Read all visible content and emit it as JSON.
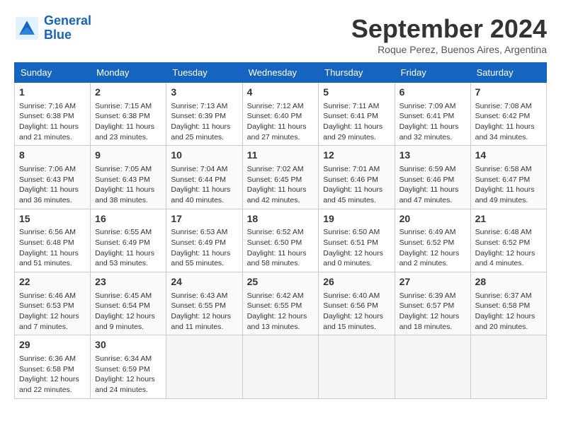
{
  "header": {
    "logo_line1": "General",
    "logo_line2": "Blue",
    "month": "September 2024",
    "location": "Roque Perez, Buenos Aires, Argentina"
  },
  "days_of_week": [
    "Sunday",
    "Monday",
    "Tuesday",
    "Wednesday",
    "Thursday",
    "Friday",
    "Saturday"
  ],
  "weeks": [
    [
      {
        "day": 1,
        "info": "Sunrise: 7:16 AM\nSunset: 6:38 PM\nDaylight: 11 hours\nand 21 minutes."
      },
      {
        "day": 2,
        "info": "Sunrise: 7:15 AM\nSunset: 6:38 PM\nDaylight: 11 hours\nand 23 minutes."
      },
      {
        "day": 3,
        "info": "Sunrise: 7:13 AM\nSunset: 6:39 PM\nDaylight: 11 hours\nand 25 minutes."
      },
      {
        "day": 4,
        "info": "Sunrise: 7:12 AM\nSunset: 6:40 PM\nDaylight: 11 hours\nand 27 minutes."
      },
      {
        "day": 5,
        "info": "Sunrise: 7:11 AM\nSunset: 6:41 PM\nDaylight: 11 hours\nand 29 minutes."
      },
      {
        "day": 6,
        "info": "Sunrise: 7:09 AM\nSunset: 6:41 PM\nDaylight: 11 hours\nand 32 minutes."
      },
      {
        "day": 7,
        "info": "Sunrise: 7:08 AM\nSunset: 6:42 PM\nDaylight: 11 hours\nand 34 minutes."
      }
    ],
    [
      {
        "day": 8,
        "info": "Sunrise: 7:06 AM\nSunset: 6:43 PM\nDaylight: 11 hours\nand 36 minutes."
      },
      {
        "day": 9,
        "info": "Sunrise: 7:05 AM\nSunset: 6:43 PM\nDaylight: 11 hours\nand 38 minutes."
      },
      {
        "day": 10,
        "info": "Sunrise: 7:04 AM\nSunset: 6:44 PM\nDaylight: 11 hours\nand 40 minutes."
      },
      {
        "day": 11,
        "info": "Sunrise: 7:02 AM\nSunset: 6:45 PM\nDaylight: 11 hours\nand 42 minutes."
      },
      {
        "day": 12,
        "info": "Sunrise: 7:01 AM\nSunset: 6:46 PM\nDaylight: 11 hours\nand 45 minutes."
      },
      {
        "day": 13,
        "info": "Sunrise: 6:59 AM\nSunset: 6:46 PM\nDaylight: 11 hours\nand 47 minutes."
      },
      {
        "day": 14,
        "info": "Sunrise: 6:58 AM\nSunset: 6:47 PM\nDaylight: 11 hours\nand 49 minutes."
      }
    ],
    [
      {
        "day": 15,
        "info": "Sunrise: 6:56 AM\nSunset: 6:48 PM\nDaylight: 11 hours\nand 51 minutes."
      },
      {
        "day": 16,
        "info": "Sunrise: 6:55 AM\nSunset: 6:49 PM\nDaylight: 11 hours\nand 53 minutes."
      },
      {
        "day": 17,
        "info": "Sunrise: 6:53 AM\nSunset: 6:49 PM\nDaylight: 11 hours\nand 55 minutes."
      },
      {
        "day": 18,
        "info": "Sunrise: 6:52 AM\nSunset: 6:50 PM\nDaylight: 11 hours\nand 58 minutes."
      },
      {
        "day": 19,
        "info": "Sunrise: 6:50 AM\nSunset: 6:51 PM\nDaylight: 12 hours\nand 0 minutes."
      },
      {
        "day": 20,
        "info": "Sunrise: 6:49 AM\nSunset: 6:52 PM\nDaylight: 12 hours\nand 2 minutes."
      },
      {
        "day": 21,
        "info": "Sunrise: 6:48 AM\nSunset: 6:52 PM\nDaylight: 12 hours\nand 4 minutes."
      }
    ],
    [
      {
        "day": 22,
        "info": "Sunrise: 6:46 AM\nSunset: 6:53 PM\nDaylight: 12 hours\nand 7 minutes."
      },
      {
        "day": 23,
        "info": "Sunrise: 6:45 AM\nSunset: 6:54 PM\nDaylight: 12 hours\nand 9 minutes."
      },
      {
        "day": 24,
        "info": "Sunrise: 6:43 AM\nSunset: 6:55 PM\nDaylight: 12 hours\nand 11 minutes."
      },
      {
        "day": 25,
        "info": "Sunrise: 6:42 AM\nSunset: 6:55 PM\nDaylight: 12 hours\nand 13 minutes."
      },
      {
        "day": 26,
        "info": "Sunrise: 6:40 AM\nSunset: 6:56 PM\nDaylight: 12 hours\nand 15 minutes."
      },
      {
        "day": 27,
        "info": "Sunrise: 6:39 AM\nSunset: 6:57 PM\nDaylight: 12 hours\nand 18 minutes."
      },
      {
        "day": 28,
        "info": "Sunrise: 6:37 AM\nSunset: 6:58 PM\nDaylight: 12 hours\nand 20 minutes."
      }
    ],
    [
      {
        "day": 29,
        "info": "Sunrise: 6:36 AM\nSunset: 6:58 PM\nDaylight: 12 hours\nand 22 minutes."
      },
      {
        "day": 30,
        "info": "Sunrise: 6:34 AM\nSunset: 6:59 PM\nDaylight: 12 hours\nand 24 minutes."
      },
      null,
      null,
      null,
      null,
      null
    ]
  ]
}
